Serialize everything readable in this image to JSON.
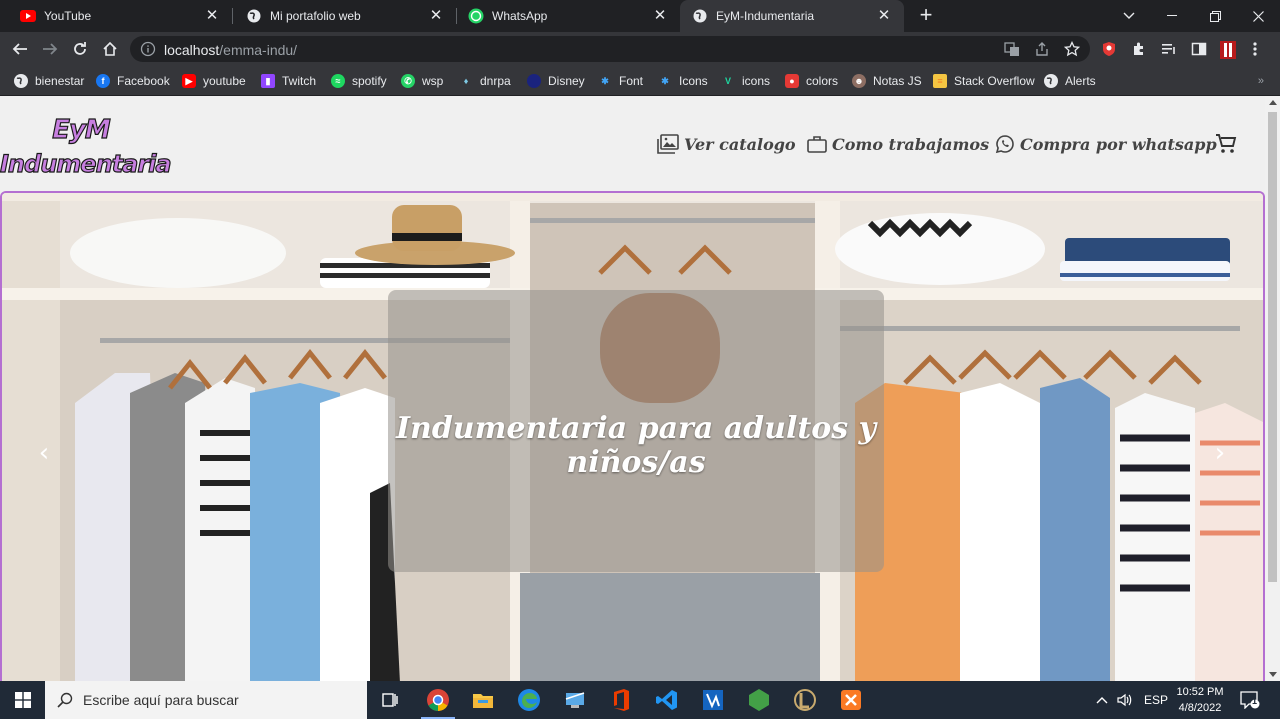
{
  "tabs": [
    {
      "title": "YouTube",
      "icon": "youtube-icon"
    },
    {
      "title": "Mi portafolio web",
      "icon": "globe-icon"
    },
    {
      "title": "WhatsApp",
      "icon": "whatsapp-icon"
    },
    {
      "title": "EyM-Indumentaria",
      "icon": "globe-icon",
      "active": true
    }
  ],
  "address": {
    "host": "localhost",
    "path": "/emma-indu/"
  },
  "bookmarks": [
    {
      "label": "bienestar",
      "icon": "globe-icon",
      "color": "#e8eaed"
    },
    {
      "label": "Facebook",
      "icon": "facebook-icon",
      "color": "#1877f2"
    },
    {
      "label": "youtube",
      "icon": "youtube-icon",
      "color": "#ff0000"
    },
    {
      "label": "Twitch",
      "icon": "twitch-icon",
      "color": "#9146ff"
    },
    {
      "label": "spotify",
      "icon": "spotify-icon",
      "color": "#1ed760"
    },
    {
      "label": "wsp",
      "icon": "whatsapp-icon",
      "color": "#25d366"
    },
    {
      "label": "dnrpa",
      "icon": "dnrpa-icon",
      "color": "#3c8dbc"
    },
    {
      "label": "Disney",
      "icon": "disney-icon",
      "color": "#1a237e"
    },
    {
      "label": "Font",
      "icon": "font-icon",
      "color": "#2196f3"
    },
    {
      "label": "Icons",
      "icon": "icons-icon",
      "color": "#2196f3"
    },
    {
      "label": "icons",
      "icon": "vuetify-icon",
      "color": "#1867c0"
    },
    {
      "label": "colors",
      "icon": "colors-icon",
      "color": "#e53935"
    },
    {
      "label": "Notas JS",
      "icon": "notas-icon",
      "color": "#8d6e63"
    },
    {
      "label": "Stack Overflow",
      "icon": "stackoverflow-icon",
      "color": "#f48024"
    },
    {
      "label": "Alerts",
      "icon": "globe-icon",
      "color": "#e8eaed"
    }
  ],
  "site": {
    "logo_line1": "EyM",
    "logo_line2": "Indumentaria",
    "nav": [
      {
        "label": "Ver catalogo",
        "icon": "images-icon"
      },
      {
        "label": "Como trabajamos",
        "icon": "briefcase-icon"
      },
      {
        "label": "Compra por whatsapp",
        "icon": "whatsapp-icon"
      }
    ],
    "hero_text": "Indumentaria para adultos y niños/as",
    "accent": "#b46fd1"
  },
  "taskbar": {
    "search_placeholder": "Escribe aquí para buscar",
    "language": "ESP",
    "time": "10:52 PM",
    "date": "4/8/2022",
    "notifications": "1"
  }
}
